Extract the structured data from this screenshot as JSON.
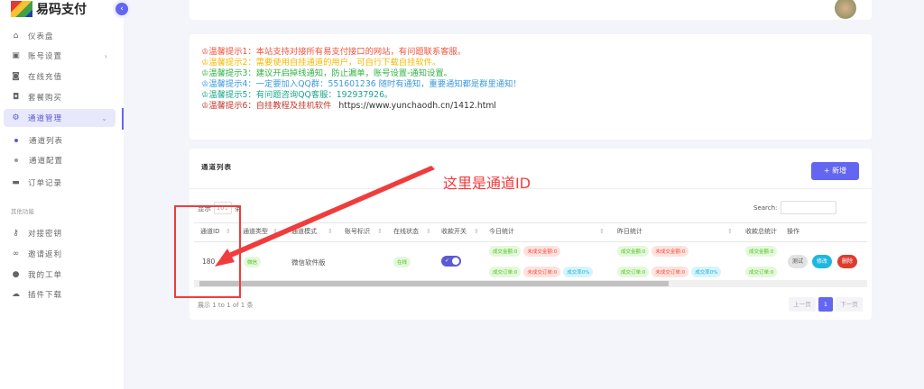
{
  "brand": {
    "name": "易码支付"
  },
  "sidebar": {
    "items": [
      {
        "label": "仪表盘",
        "icon": "home-icon"
      },
      {
        "label": "账号设置",
        "icon": "user-card-icon"
      },
      {
        "label": "在线充值",
        "icon": "recharge-icon"
      },
      {
        "label": "套餐购买",
        "icon": "bag-icon"
      },
      {
        "label": "通道管理",
        "icon": "gear-icon"
      },
      {
        "label": "通道列表"
      },
      {
        "label": "通道配置"
      },
      {
        "label": "订单记录",
        "icon": "wallet-icon"
      }
    ],
    "group_label": "其他功能",
    "other_items": [
      {
        "label": "对接密钥",
        "icon": "key-icon"
      },
      {
        "label": "邀请返利",
        "icon": "link-icon"
      },
      {
        "label": "我的工单",
        "icon": "message-icon"
      },
      {
        "label": "插件下载",
        "icon": "cloud-download-icon"
      }
    ]
  },
  "tips": [
    {
      "text": "♔温馨提示1：本站支持对接所有易支付接口的网站，有问题联系客服。",
      "color": "#f0533c"
    },
    {
      "text": "♔温馨提示2：需要使用自挂通道的用户，可自行下载自挂软件。",
      "color": "#f5b800"
    },
    {
      "text": "♔温馨提示3：建议开启掉线通知，防止漏单，账号设置-通知设置。",
      "color": "#2fb344"
    },
    {
      "text": "♔温馨提示4：一定要加入QQ群：551601236 随时有通知，重要通知都是群里通知！",
      "color": "#3b9ae1"
    },
    {
      "text": "♔温馨提示5：有问题咨询QQ客服：192937926。",
      "color": "#1aa58a"
    },
    {
      "text": "♔温馨提示6：自挂教程及挂机软件",
      "color": "#c0392b",
      "url": "https://www.yunchaodh.cn/1412.html"
    }
  ],
  "table_card": {
    "title": "通道列表",
    "add_label": "+ 新增",
    "show_prefix": "显示",
    "page_size": "10",
    "show_suffix": "条",
    "search_label": "Search:",
    "columns": [
      "通道ID",
      "通道类型",
      "通道模式",
      "账号标识",
      "在线状态",
      "收款开关",
      "今日统计",
      "昨日统计",
      "收款总统计",
      "操作"
    ],
    "rows": [
      {
        "id": "180",
        "type": "微信",
        "mode": "微信软件版",
        "account": "",
        "online": "在线",
        "switch_on": true,
        "today": {
          "amount": "成交金额:0",
          "unpaid_amount": "未成交金额:0",
          "orders": "成交订单:0",
          "unpaid_orders": "未成交订单:0",
          "rate": "成交率0%"
        },
        "yesterday": {
          "amount": "成交金额:0",
          "unpaid_amount": "未成交金额:0",
          "orders": "成交订单:0",
          "unpaid_orders": "未成交订单:0",
          "rate": "成交率0%"
        },
        "total": {
          "amount": "成交金额:0",
          "orders": "成交订单:0"
        },
        "actions": [
          "测试",
          "修改",
          "删除"
        ]
      }
    ],
    "info": "展示 1 to 1 of 1 条",
    "pagination": {
      "prev": "上一页",
      "current": "1",
      "next": "下一页"
    }
  },
  "annotation": {
    "text": "这里是通道ID",
    "color": "#f03c3c"
  }
}
